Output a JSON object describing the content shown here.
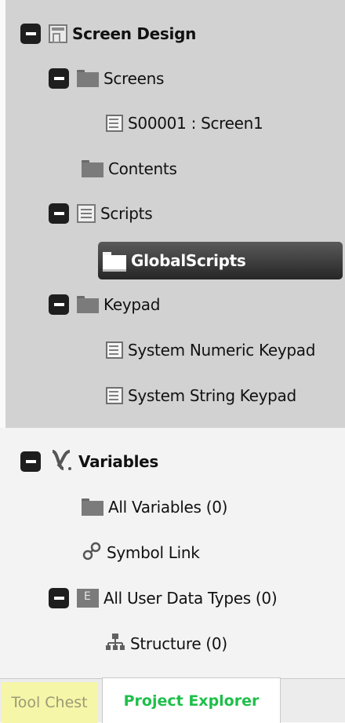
{
  "tree": {
    "screen_design": "Screen Design",
    "screens": "Screens",
    "screen1": "S00001 : Screen1",
    "contents": "Contents",
    "scripts": "Scripts",
    "global_scripts": "GlobalScripts",
    "keypad": "Keypad",
    "numeric_keypad": "System Numeric Keypad",
    "string_keypad": "System String Keypad",
    "variables": "Variables",
    "all_variables": "All Variables (0)",
    "symbol_link": "Symbol Link",
    "all_user_data_types": "All User Data Types (0)",
    "structure": "Structure (0)"
  },
  "tabs": {
    "tool_chest": "Tool Chest",
    "project_explorer": "Project Explorer"
  },
  "icons": {
    "screen_design": "screen-window-icon",
    "folder": "folder-icon",
    "document": "document-icon",
    "scripts": "script-icon",
    "global_scripts": "globe-folder-icon",
    "variables": "variable-x-icon",
    "symbol_link": "chain-link-icon",
    "user_data_types": "data-type-icon",
    "structure": "hierarchy-icon"
  },
  "colors": {
    "top_section_bg": "#d2d2d2",
    "bottom_section_bg": "#f3f3f3",
    "selected_bg": "#2f2f2f",
    "project_explorer_tab_text": "#1fbf4a",
    "tool_chest_highlight": "#f6f6a8"
  }
}
